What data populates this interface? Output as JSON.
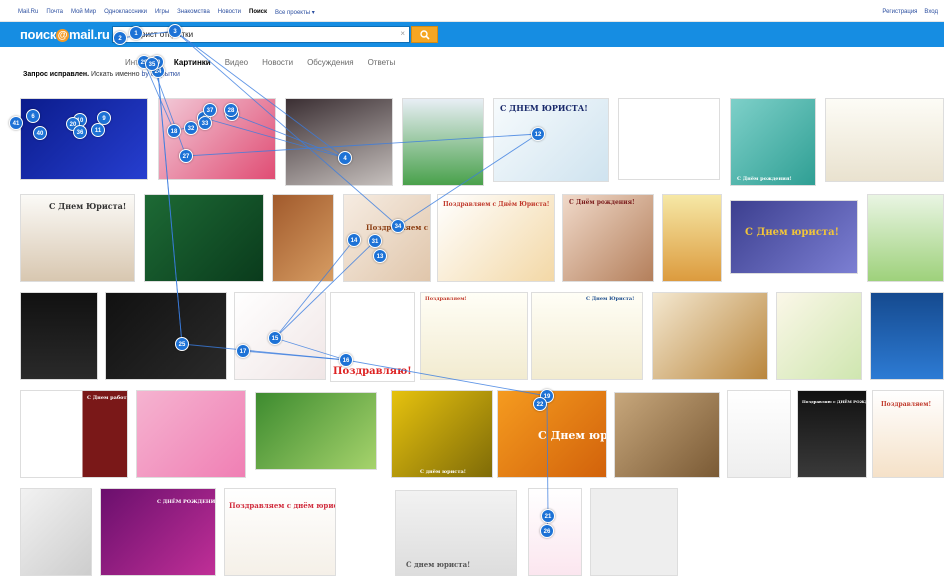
{
  "topbar": {
    "nav": [
      "Mail.Ru",
      "Почта",
      "Мой Мир",
      "Одноклассники",
      "Игры",
      "Знакомства",
      "Новости",
      "Поиск",
      "Все проекты ▾"
    ],
    "active": "Поиск",
    "register": "Регистрация",
    "login": "Вход"
  },
  "header": {
    "logo_text": "поиск",
    "logo_at": "@",
    "logo_domain": "mail.ru",
    "search_value": "юрист открытки",
    "clear": "×"
  },
  "tabs": [
    "Интернет",
    "Картинки",
    "Видео",
    "Новости",
    "Обсуждения",
    "Ответы"
  ],
  "active_tab": "Картинки",
  "correction": {
    "bold": "Запрос исправлен.",
    "text": " Искать именно ",
    "alt_query": "by открытки"
  },
  "captions": {
    "t2": "С Днем Юриста!",
    "t5": "С ДНЕМ ЮРИСТА!",
    "t9": "С Днём рождения!",
    "t11": "С Днем юриста!",
    "t16": "С Днём рождения!",
    "t19": "С днем юриста!",
    "t28": "Поздравляю!",
    "t29": "Поздравляем с Днём Юриста!",
    "t30": "Поздравляем с Днём Юриста!",
    "t33": "Поздравляем!",
    "t34": "С Днем работников прокуратуры",
    "t37": "С днём юриста!",
    "t38": "С Днем юриста!",
    "t41": "Поздравляю с ДНЁМ РОЖДЕНИЯ!!!",
    "t42": "Поздравляем!",
    "t43": "С Днем Юриста!",
    "t44": "С ДНЁМ РОЖДЕНИЯ!!!",
    "t45": "Поздравляем с днём юриста!",
    "t46": "С днем юриста!"
  },
  "badges": [
    "1",
    "2",
    "3",
    "4",
    "6",
    "8",
    "9",
    "10",
    "11",
    "12",
    "13",
    "14",
    "15",
    "16",
    "17",
    "18",
    "19",
    "20",
    "21",
    "22",
    "23",
    "24",
    "25",
    "26",
    "27",
    "28",
    "29",
    "30",
    "31",
    "32",
    "33",
    "34",
    "35",
    "36",
    "37",
    "40",
    "41"
  ],
  "colors": {
    "header_blue": "#168de2",
    "search_orange": "#f5a623",
    "badge_blue": "#1d72d6",
    "link_blue": "#2c4fa0"
  }
}
